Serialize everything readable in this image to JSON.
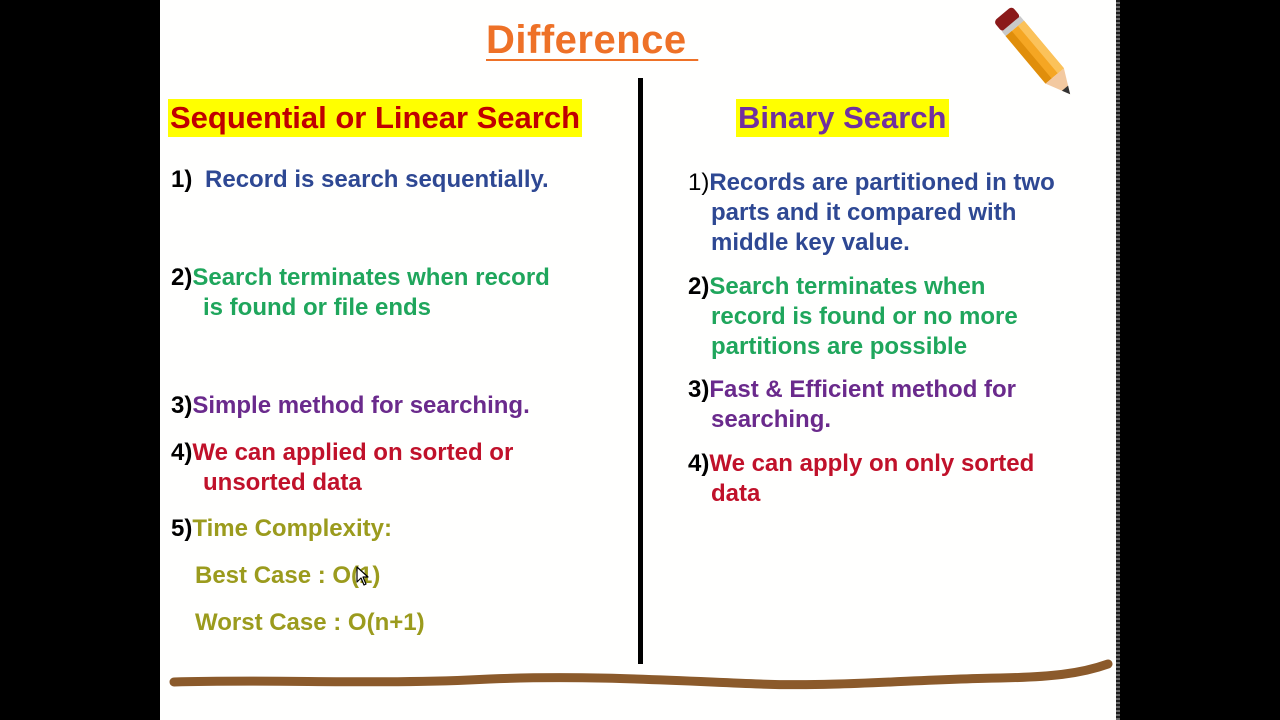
{
  "title": "Difference ",
  "left": {
    "heading": "Sequential or Linear Search",
    "items": [
      {
        "num": "1)",
        "text": "Record is search sequentially.",
        "cont": ""
      },
      {
        "num": "2)",
        "text": "Search terminates when record",
        "cont": "is found or file ends"
      },
      {
        "num": "3)",
        "text": "Simple method for searching.",
        "cont": ""
      },
      {
        "num": "4)",
        "text": "We can applied on sorted or",
        "cont": "unsorted data"
      },
      {
        "num": "5)",
        "text": "Time Complexity:",
        "cont": ""
      }
    ],
    "best_case": "Best Case : O(1)",
    "worst_case": "Worst Case : O(n+1)"
  },
  "right": {
    "heading": "Binary Search",
    "items": [
      {
        "num": "1)",
        "lines": [
          "Records are partitioned in two",
          "parts and it compared with",
          "middle key value."
        ]
      },
      {
        "num": "2)",
        "lines": [
          "Search terminates when",
          "record is found or no more",
          "partitions are possible"
        ]
      },
      {
        "num": "3)",
        "lines": [
          "Fast & Efficient method for",
          "searching."
        ]
      },
      {
        "num": "4)",
        "lines": [
          "We can apply on only sorted",
          "data"
        ]
      }
    ]
  },
  "icons": {
    "pencil": "pencil-icon",
    "cursor": "mouse-cursor-icon"
  },
  "colors": {
    "title": "#ee7127",
    "heading_bg": "#ffff00",
    "left_heading": "#c00000",
    "right_heading": "#7030a0",
    "blue": "#2e4893",
    "green": "#1fa65c",
    "purple": "#6a2a8c",
    "red": "#c0112a",
    "olive": "#9b9b1d",
    "ground": "#8b5a2b"
  }
}
